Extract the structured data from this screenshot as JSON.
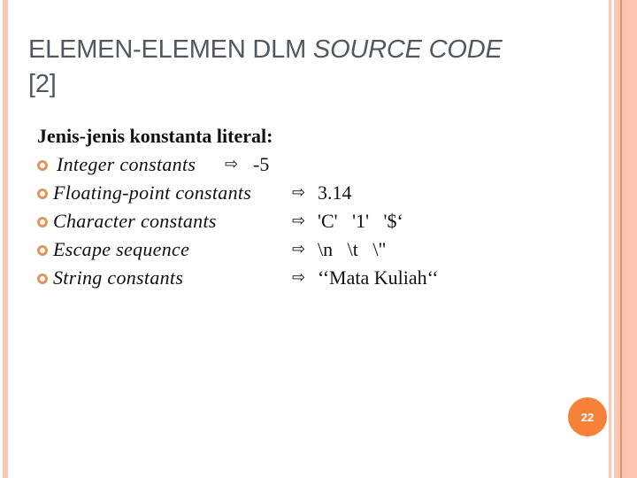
{
  "slide": {
    "title_plain": "ELEMEN-ELEMEN DLM ",
    "title_italic": "SOURCE CODE",
    "title_line2": "[2]",
    "heading": "Jenis-jenis konstanta literal:",
    "arrow_glyph": "⇨",
    "items": [
      {
        "label": "Integer constants",
        "value": "-5"
      },
      {
        "label": "Floating-point constants",
        "value": "3.14"
      },
      {
        "label": "Character constants",
        "value": "'C'   '1'   '$‘"
      },
      {
        "label": "Escape sequence",
        "value": "\\n   \\t   \\\""
      },
      {
        "label": "String constants",
        "value": "‘‘Mata Kuliah‘‘"
      }
    ],
    "page_number": "22"
  },
  "colors": {
    "accent": "#f6823a",
    "bullet": "#e0955a",
    "border": "#fbc8b4",
    "title_text": "#525760"
  },
  "icons": {
    "bullet": "ring-bullet-icon",
    "arrow": "right-arrow-outline-icon"
  }
}
